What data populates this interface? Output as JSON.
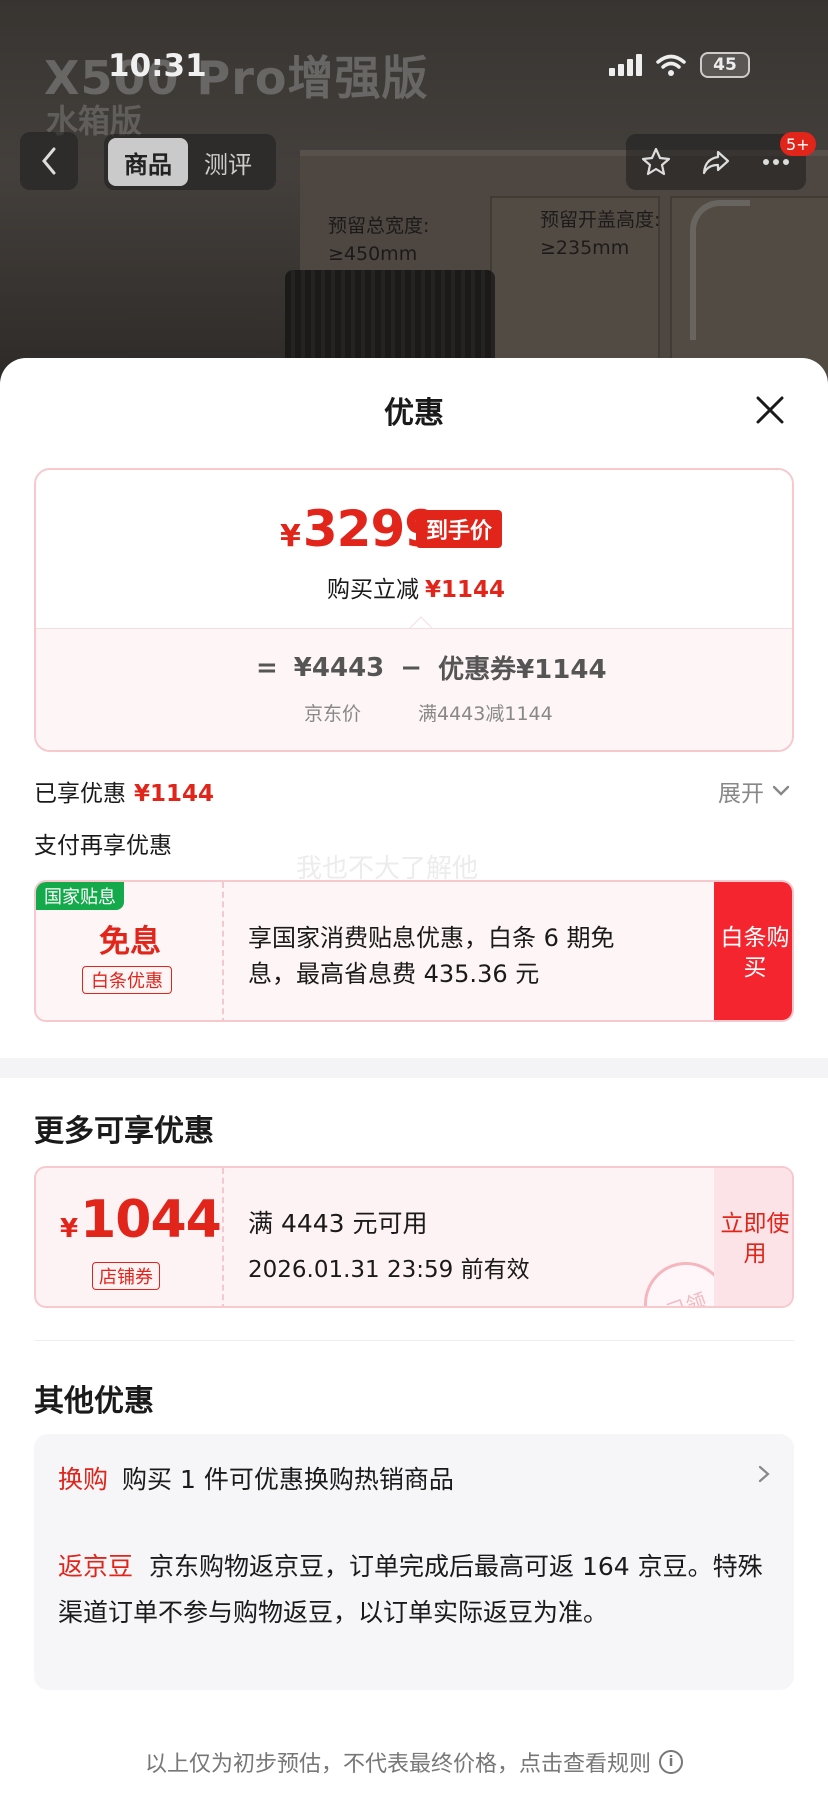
{
  "background": {
    "product_title": "X500 Pro增强版",
    "product_subtitle": "水箱版",
    "spec_width_label": "预留总宽度:",
    "spec_width_value": "≥450mm",
    "spec_height_label": "预留开盖高度:",
    "spec_height_value": "≥235mm"
  },
  "status_bar": {
    "time": "10:31",
    "battery": "45"
  },
  "nav": {
    "tabs": [
      {
        "label": "商品",
        "active": true
      },
      {
        "label": "测评",
        "active": false
      }
    ],
    "badge": "5+"
  },
  "sheet": {
    "title": "优惠",
    "price_card": {
      "currency": "¥",
      "final_price": "3299",
      "final_tag": "到手价",
      "discount_label": "购买立减",
      "discount_value": "¥1144",
      "formula_eq": "=",
      "jd_price": "¥4443",
      "minus": "−",
      "coupon_label": "优惠券",
      "coupon_value": "¥1144",
      "jd_price_caption": "京东价",
      "coupon_caption": "满4443减1144"
    },
    "enjoyed_label": "已享优惠",
    "enjoyed_value": "¥1144",
    "expand_label": "展开",
    "pay_more_label": "支付再享优惠",
    "watermark": "我也不大了解他",
    "subsidy": {
      "tag": "国家贴息",
      "big": "免息",
      "small": "白条优惠",
      "desc": "享国家消费贴息优惠，白条 6 期免息，最高省息费 435.36 元",
      "button": "白条购买"
    },
    "more_title": "更多可享优惠",
    "coupon": {
      "currency": "¥",
      "amount": "1044",
      "type": "店铺券",
      "condition": "满 4443 元可用",
      "valid_until": "2026.01.31 23:59 前有效",
      "button": "立即使用",
      "stamp": "已领"
    },
    "other_title": "其他优惠",
    "other": {
      "exchange_tag": "换购",
      "exchange_text": "购买 1 件可优惠换购热销商品",
      "beans_tag": "返京豆",
      "beans_text": "京东购物返京豆，订单完成后最高可返 164 京豆。特殊渠道订单不参与购物返豆，以订单实际返豆为准。"
    },
    "disclaimer": "以上仅为初步预估，不代表最终价格，点击查看规则"
  },
  "colors": {
    "accent": "#e1251b",
    "subsidy_green": "#14a94b"
  }
}
